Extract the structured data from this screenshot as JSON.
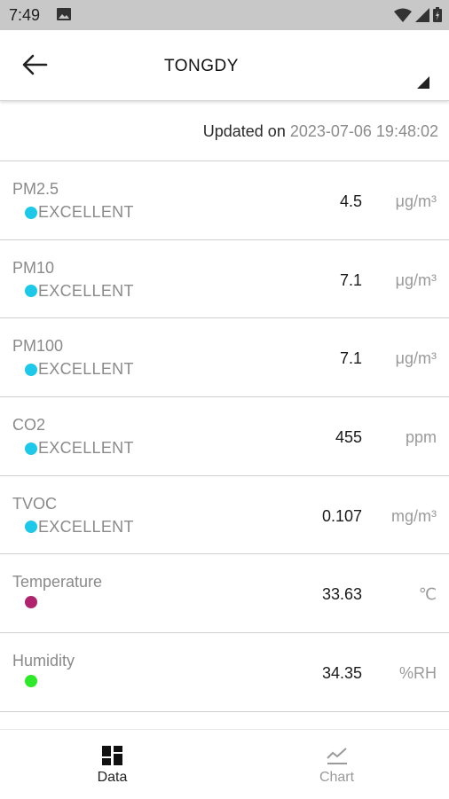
{
  "status_bar": {
    "time": "7:49"
  },
  "app_bar": {
    "title": "TONGDY"
  },
  "updated": {
    "label": "Updated on",
    "timestamp": "2023-07-06 19:48:02"
  },
  "metrics": [
    {
      "name": "PM2.5",
      "status": "EXCELLENT",
      "dot_color": "#1ec8e8",
      "value": "4.5",
      "unit": "μg/m³"
    },
    {
      "name": "PM10",
      "status": "EXCELLENT",
      "dot_color": "#1ec8e8",
      "value": "7.1",
      "unit": "μg/m³"
    },
    {
      "name": "PM100",
      "status": "EXCELLENT",
      "dot_color": "#1ec8e8",
      "value": "7.1",
      "unit": "μg/m³"
    },
    {
      "name": "CO2",
      "status": "EXCELLENT",
      "dot_color": "#1ec8e8",
      "value": "455",
      "unit": "ppm"
    },
    {
      "name": "TVOC",
      "status": "EXCELLENT",
      "dot_color": "#1ec8e8",
      "value": "0.107",
      "unit": "mg/m³"
    },
    {
      "name": "Temperature",
      "status": "",
      "dot_color": "#b0246e",
      "value": "33.63",
      "unit": "℃"
    },
    {
      "name": "Humidity",
      "status": "",
      "dot_color": "#2ee82a",
      "value": "34.35",
      "unit": "%RH"
    }
  ],
  "bottom_nav": {
    "data_label": "Data",
    "chart_label": "Chart"
  }
}
